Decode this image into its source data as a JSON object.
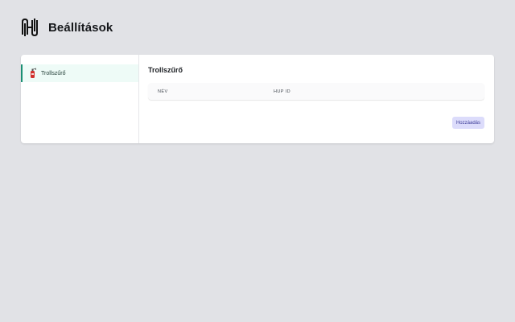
{
  "header": {
    "title": "Beállítások",
    "logo_icon": "hup-logo-icon"
  },
  "sidebar": {
    "items": [
      {
        "label": "Trollszűrő",
        "icon": "fire-extinguisher-icon",
        "active": true
      }
    ]
  },
  "main": {
    "title": "Trollszűrő",
    "table": {
      "columns": [
        "NÉV",
        "HUP ID"
      ],
      "rows": []
    },
    "add_button_label": "Hozzáadás"
  },
  "colors": {
    "background": "#e1e2e6",
    "active_item_bg": "#eefbf7",
    "active_item_border": "#1a8f73",
    "button_bg": "#dcdcfb",
    "button_text": "#3d3d98"
  }
}
